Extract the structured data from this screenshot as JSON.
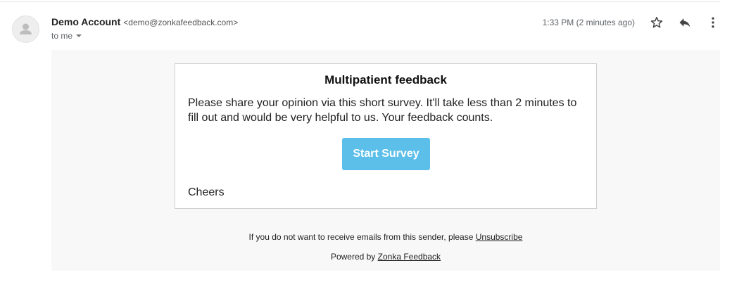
{
  "header": {
    "sender_name": "Demo Account",
    "sender_email": "<demo@zonkafeedback.com>",
    "recipient": "to me",
    "timestamp": "1:33 PM (2 minutes ago)"
  },
  "icons": {
    "avatar": "person-icon",
    "star": "star-icon",
    "reply": "reply-icon",
    "more": "more-vert-icon",
    "recipient_caret": "caret-down-icon"
  },
  "email": {
    "title": "Multipatient feedback",
    "message": "Please share your opinion via this short survey. It'll take less than 2 minutes to fill out and would be very helpful to us. Your feedback counts.",
    "button_label": "Start Survey",
    "signoff": "Cheers"
  },
  "footer": {
    "unsubscribe_prefix": "If you do not want to receive emails from this sender, please",
    "unsubscribe_link": "Unsubscribe",
    "powered_prefix": "Powered by",
    "powered_link": "Zonka Feedback"
  },
  "colors": {
    "button_bg": "#5bbfea",
    "body_bg": "#f8f8f8",
    "card_border": "#cfcfcf"
  }
}
